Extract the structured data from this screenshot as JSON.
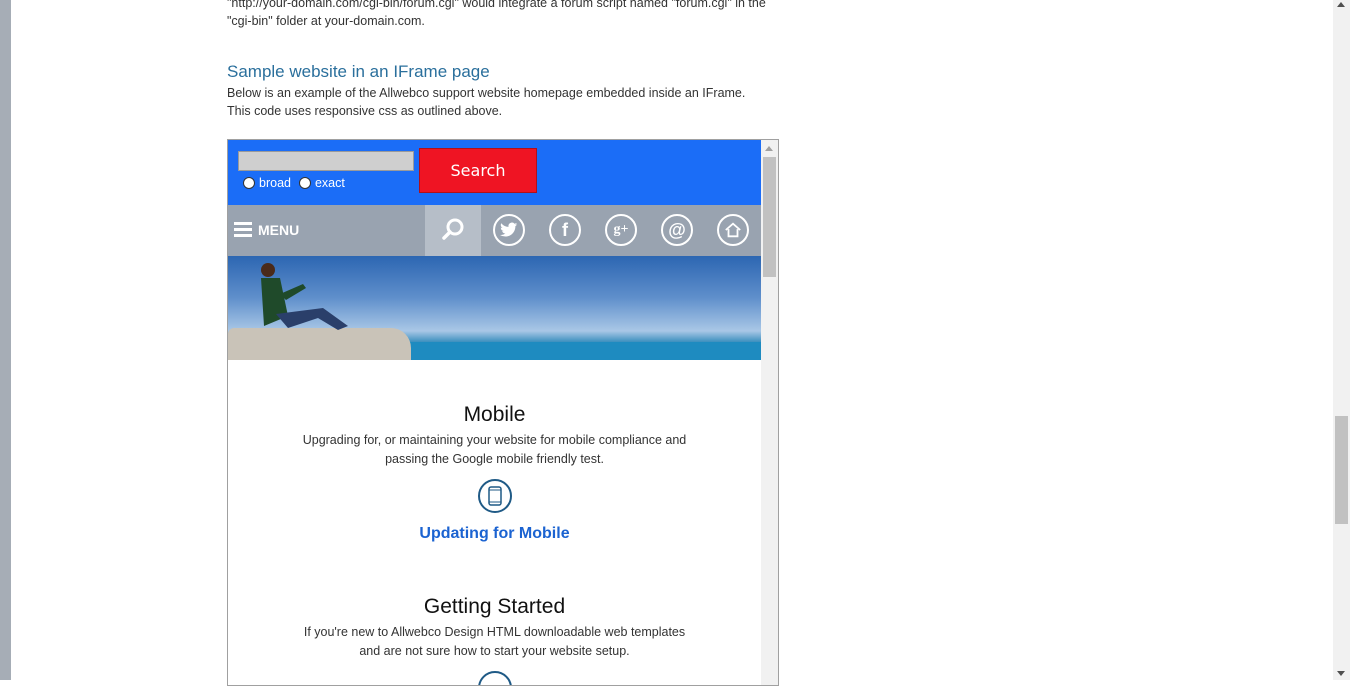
{
  "intro": {
    "text": "\"http://your-domain.com/cgi-bin/forum.cgi\" would integrate a forum script named \"forum.cgi\" in the \"cgi-bin\" folder at your-domain.com."
  },
  "section": {
    "heading": "Sample website in an IFrame page",
    "description": "Below is an example of the Allwebco support website homepage embedded inside an IFrame. This code uses responsive css as outlined above."
  },
  "site": {
    "search": {
      "input_value": "",
      "button_label": "Search",
      "radio_broad": "broad",
      "radio_exact": "exact"
    },
    "nav": {
      "menu_label": "MENU",
      "icons": [
        "search-icon",
        "twitter-icon",
        "facebook-icon",
        "google-plus-icon",
        "email-icon",
        "home-icon"
      ]
    },
    "services": [
      {
        "title": "Mobile",
        "text": "Upgrading for, or maintaining your website for mobile compliance and passing the Google mobile friendly test.",
        "link": "Updating for Mobile"
      },
      {
        "title": "Getting Started",
        "text": "If you're new to Allwebco Design HTML downloadable web templates and are not sure how to start your website setup."
      }
    ]
  },
  "colors": {
    "header_blue": "#1b6df7",
    "search_red": "#ef1423",
    "nav_gray": "#99a3b0",
    "heading_blue": "#2a6f9c",
    "link_blue": "#1b63d1"
  }
}
